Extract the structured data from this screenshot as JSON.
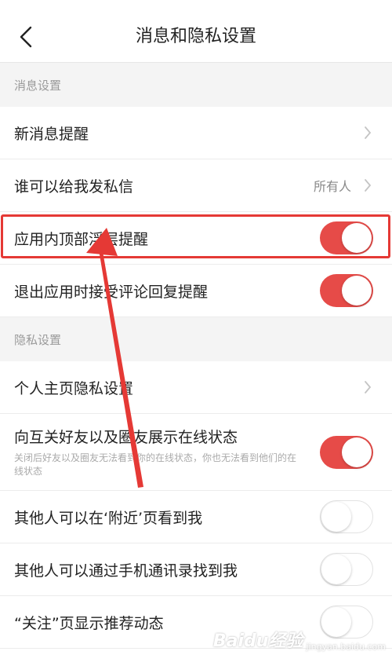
{
  "header": {
    "title": "消息和隐私设置"
  },
  "sections": {
    "message": {
      "header": "消息设置",
      "new_message": {
        "label": "新消息提醒"
      },
      "who_can_message": {
        "label": "谁可以给我发私信",
        "value": "所有人"
      },
      "in_app_banner": {
        "label": "应用内顶部浮层提醒",
        "state": "on"
      },
      "exit_comment_reply": {
        "label": "退出应用时接受评论回复提醒",
        "state": "on"
      }
    },
    "privacy": {
      "header": "隐私设置",
      "profile_privacy": {
        "label": "个人主页隐私设置"
      },
      "online_status": {
        "label": "向互关好友以及圈友展示在线状态",
        "sub": "关闭后好友以及圈友无法看到你的在线状态，你也无法看到他们的在线状态",
        "state": "on"
      },
      "nearby": {
        "label": "其他人可以在‘附近’页看到我",
        "state": "off"
      },
      "contacts": {
        "label": "其他人可以通过手机通讯录找到我",
        "state": "off"
      },
      "follow_recommend": {
        "label": "“关注”页显示推荐动态",
        "state": "off"
      }
    }
  },
  "watermark": {
    "text": "Baidu经验",
    "sub": "jingyan.baidu.com"
  },
  "colors": {
    "accent": "#e64b48",
    "highlight": "#e53935"
  },
  "icons": {
    "back": "chevron-left-icon",
    "row_chevron": "chevron-right-icon"
  }
}
